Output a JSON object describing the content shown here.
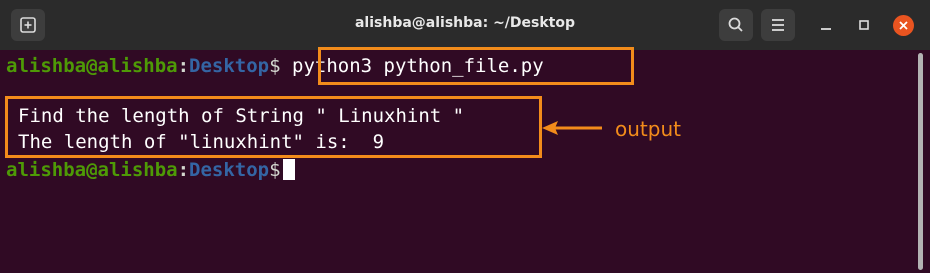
{
  "window": {
    "title": "alishba@alishba: ~/Desktop"
  },
  "prompt": {
    "user_host": "alishba@alishba",
    "colon": ":",
    "path": "Desktop",
    "symbol": "$"
  },
  "command": " python3 python_file.py",
  "output": [
    "Find the length of String \" Linuxhint \"",
    "The length of \"linuxhint\" is:  9"
  ],
  "annotation": {
    "label": "output"
  },
  "icons": [
    "new-tab-icon",
    "search-icon",
    "menu-icon",
    "minimize-icon",
    "maximize-icon",
    "close-icon"
  ],
  "colors": {
    "background": "#300a24",
    "user": "#4e9a06",
    "path": "#3465a4",
    "annotation": "#f28c1b",
    "close": "#e95420"
  }
}
